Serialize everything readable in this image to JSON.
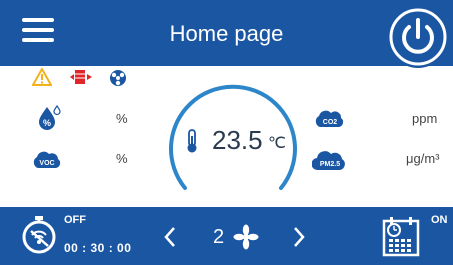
{
  "header": {
    "title": "Home page",
    "menu_icon": "hamburger-menu-icon",
    "power_icon": "power-icon"
  },
  "alerts": [
    "warning-triangle-icon",
    "filter-alert-icon",
    "fan-alert-icon"
  ],
  "sensors": {
    "humidity": {
      "icon": "humidity-icon",
      "unit": "%"
    },
    "voc": {
      "icon": "voc-icon",
      "label": "VOC",
      "unit": "%"
    },
    "co2": {
      "icon": "co2-icon",
      "label": "CO2",
      "unit": "ppm"
    },
    "pm25": {
      "icon": "pm25-icon",
      "label": "PM2.5",
      "unit": "μg/m³"
    }
  },
  "temperature": {
    "value": "23.5",
    "unit": "℃",
    "icon": "thermometer-icon"
  },
  "footer": {
    "timer": {
      "state": "OFF",
      "time": "00 : 30 : 00",
      "icon": "timer-icon"
    },
    "fan": {
      "speed": "2",
      "prev_icon": "chevron-left-icon",
      "next_icon": "chevron-right-icon",
      "icon": "fan-icon"
    },
    "schedule": {
      "state": "ON",
      "icon": "schedule-calendar-icon"
    }
  },
  "colors": {
    "primary": "#1b56a3",
    "gauge": "#2d86c9",
    "alert_yellow": "#f3b21b",
    "alert_red": "#e0262a",
    "icon_blue": "#1b56a3"
  }
}
